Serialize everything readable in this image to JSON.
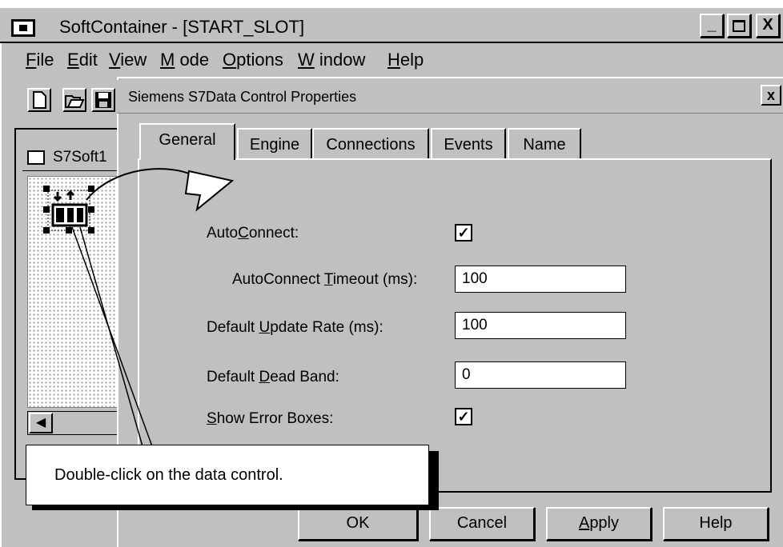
{
  "window": {
    "title": "SoftContainer - [START_SLOT]",
    "controls": {
      "minimize": "_",
      "restore": "🗗",
      "close": "X"
    }
  },
  "menu": [
    {
      "pre": "",
      "key": "F",
      "post": "ile"
    },
    {
      "pre": "",
      "key": "E",
      "post": "dit"
    },
    {
      "pre": "",
      "key": "V",
      "post": "iew"
    },
    {
      "pre": "",
      "key": "M",
      "post": " ode"
    },
    {
      "pre": "",
      "key": "O",
      "post": "ptions"
    },
    {
      "pre": "",
      "key": "W",
      "post": " indow"
    },
    {
      "pre": "",
      "key": "H",
      "post": "elp"
    }
  ],
  "toolbar": {
    "icons": [
      "new-file-icon",
      "open-folder-icon",
      "save-disk-icon"
    ]
  },
  "subwindow": {
    "title": "S7Soft1",
    "scroll_left": "◀"
  },
  "dialog": {
    "title": "Siemens S7Data Control Properties",
    "close": "x",
    "tabs": [
      "General",
      "Engine",
      "Connections",
      "Events",
      "Name"
    ],
    "active_tab": "General",
    "fields": {
      "autoconnect": {
        "pre": "Auto",
        "key": "C",
        "post": "onnect:",
        "checked": true,
        "mark": "✓"
      },
      "timeout": {
        "pre": "AutoConnect ",
        "key": "T",
        "post": "imeout (ms):",
        "value": "100"
      },
      "update_rate": {
        "pre": "Default ",
        "key": "U",
        "post": "pdate Rate (ms):",
        "value": "100"
      },
      "dead_band": {
        "pre": "Default ",
        "key": "D",
        "post": "ead Band:",
        "value": "0"
      },
      "show_errors": {
        "pre": "",
        "key": "S",
        "post": "how Error Boxes:",
        "checked": true,
        "mark": "✓"
      }
    },
    "buttons": {
      "ok": "OK",
      "cancel": "Cancel",
      "apply_pre": "",
      "apply_key": "A",
      "apply_post": "pply",
      "help": "Help"
    }
  },
  "callout": {
    "text": "Double-click on the data control."
  }
}
